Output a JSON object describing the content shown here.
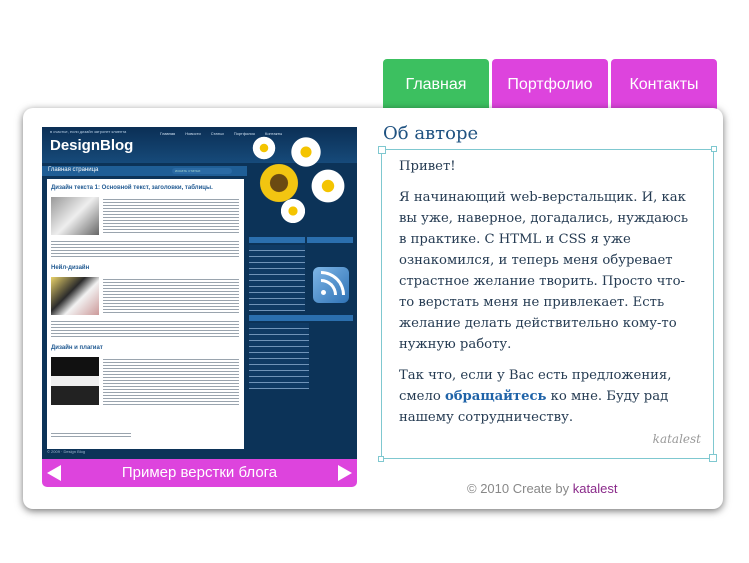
{
  "tabs": [
    {
      "label": "Главная",
      "active": true
    },
    {
      "label": "Портфолио",
      "active": false
    },
    {
      "label": "Контакты",
      "active": false
    }
  ],
  "colors": {
    "tab_active": "#3cc060",
    "tab_inactive": "#dd44dd",
    "accent": "#dd44dd",
    "title": "#1f5281",
    "frame_border": "#7fc8d0"
  },
  "preview": {
    "tagline": "в счастье, если дизайн затронет клиента",
    "logo": "DesignBlog",
    "nav": [
      "Главная",
      "Новости",
      "Статьи",
      "Портфолио",
      "Контакты"
    ],
    "section_heading": "Главная страница",
    "search_placeholder": "искать статьи",
    "articles": [
      {
        "title": "Дизайн текста 1: Основной текст, заголовки, таблицы."
      },
      {
        "title": "Нейл-дизайн"
      },
      {
        "title": "Дизайн и плагиат"
      }
    ],
    "sidebar_headings": [
      "Популярные статьи",
      "RSS подписка",
      "Полезные ссылки"
    ],
    "footer": "© 2009 · Design Blog",
    "caption": "Пример верстки блога",
    "prev_icon": "arrow-left-icon",
    "next_icon": "arrow-right-icon"
  },
  "about": {
    "title": "Об авторе",
    "greeting": "Привет!",
    "paragraph1": "Я начинающий web-верстальщик. И, как вы уже, наверное, догадались, нуждаюсь в практике. С HTML и CSS я уже ознакомился, и теперь меня обуревает страстное желание творить. Просто что-то верстать меня не привлекает. Есть желание делать действительно кому-то нужную работу.",
    "paragraph2_before": "Так что, если у Вас есть предложения, смело",
    "paragraph2_link": "обращайтесь",
    "paragraph2_after": "ко мне. Буду рад нашему сотрудничеству.",
    "signature": "katalest"
  },
  "footer": {
    "copyright": "© 2010 Create by",
    "author": "katalest"
  }
}
